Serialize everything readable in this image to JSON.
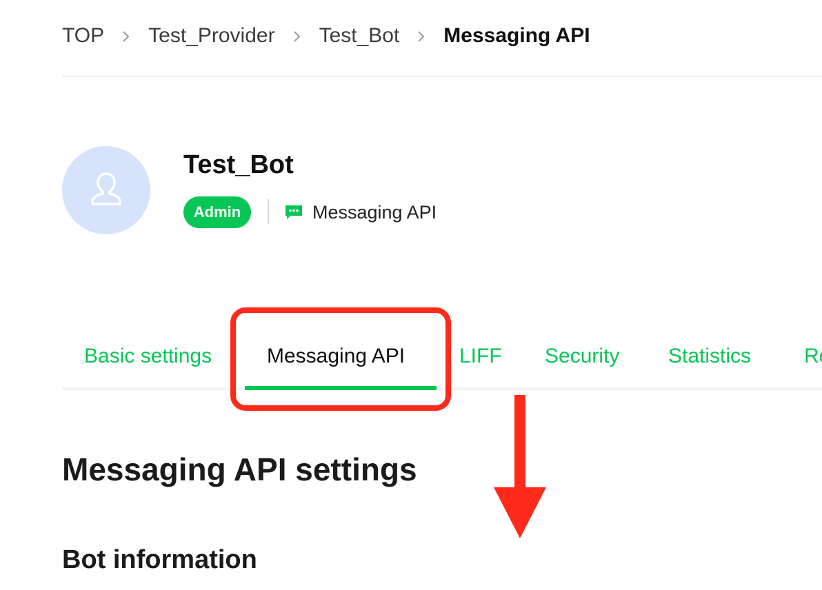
{
  "breadcrumb": {
    "items": [
      "TOP",
      "Test_Provider",
      "Test_Bot",
      "Messaging API"
    ]
  },
  "channel": {
    "name": "Test_Bot",
    "role_badge": "Admin",
    "type_label": "Messaging API",
    "type_icon": "chat-bubble-icon",
    "avatar_icon": "user-icon"
  },
  "tabs": {
    "items": [
      "Basic settings",
      "Messaging API",
      "LIFF",
      "Security",
      "Statistics",
      "Ro"
    ],
    "active": "Messaging API"
  },
  "annotation": {
    "highlight_color": "#ff2a1a",
    "arrow_icon": "down-arrow-icon"
  },
  "content": {
    "section_title": "Messaging API settings",
    "subsection_title": "Bot information"
  },
  "colors": {
    "accent": "#06c755",
    "avatar_bg": "#d7e3fa"
  }
}
